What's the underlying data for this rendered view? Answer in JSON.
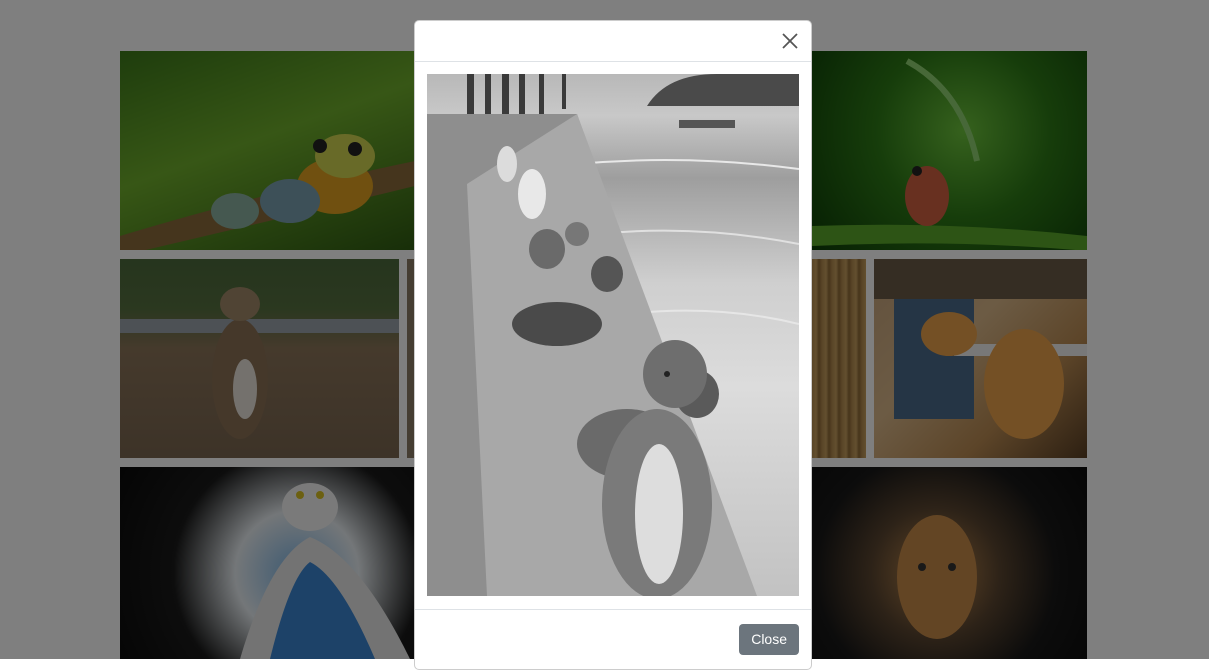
{
  "gallery": {
    "tiles": [
      {
        "subject": "frogs-on-branch"
      },
      {
        "subject": "frog-with-leaf-umbrella"
      },
      {
        "subject": "cat-on-rail"
      },
      {
        "subject": "cat-partial"
      },
      {
        "subject": "bamboo-partial"
      },
      {
        "subject": "cat-with-tape-measure"
      },
      {
        "subject": "cat-in-dress"
      },
      {
        "subject": "cat-in-bag"
      }
    ]
  },
  "modal": {
    "close_icon": "close-icon",
    "image_subject": "cats-on-pier",
    "footer": {
      "close_label": "Close"
    }
  },
  "colors": {
    "backdrop": "#000000",
    "modal_bg": "#ffffff",
    "button_secondary": "#6c757d",
    "divider": "#dee2e6"
  }
}
